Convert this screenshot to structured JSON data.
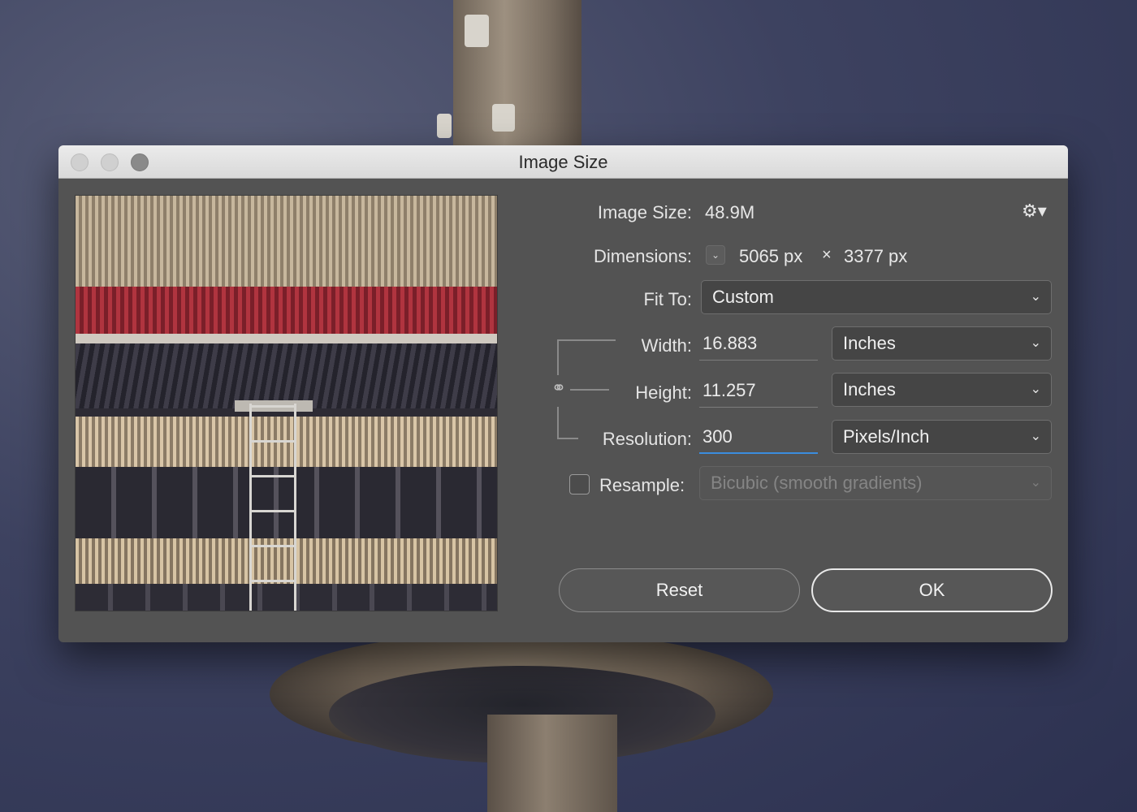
{
  "window": {
    "title": "Image Size"
  },
  "image_size": {
    "label": "Image Size:",
    "value": "48.9M"
  },
  "dimensions": {
    "label": "Dimensions:",
    "width_value": "5065 px",
    "separator": "×",
    "height_value": "3377 px"
  },
  "fit_to": {
    "label": "Fit To:",
    "value": "Custom"
  },
  "width": {
    "label": "Width:",
    "value": "16.883",
    "unit": "Inches"
  },
  "height": {
    "label": "Height:",
    "value": "11.257",
    "unit": "Inches"
  },
  "resolution": {
    "label": "Resolution:",
    "value": "300",
    "unit": "Pixels/Inch"
  },
  "resample": {
    "label": "Resample:",
    "checked": false,
    "method": "Bicubic (smooth gradients)"
  },
  "buttons": {
    "reset": "Reset",
    "ok": "OK"
  },
  "icons": {
    "gear": "gear-icon",
    "chevron": "chevron-down-icon",
    "link": "chain-link-icon"
  },
  "colors": {
    "dialog_bg": "#535353",
    "focus_accent": "#3b8dde",
    "titlebar": "#e0e0e0"
  }
}
